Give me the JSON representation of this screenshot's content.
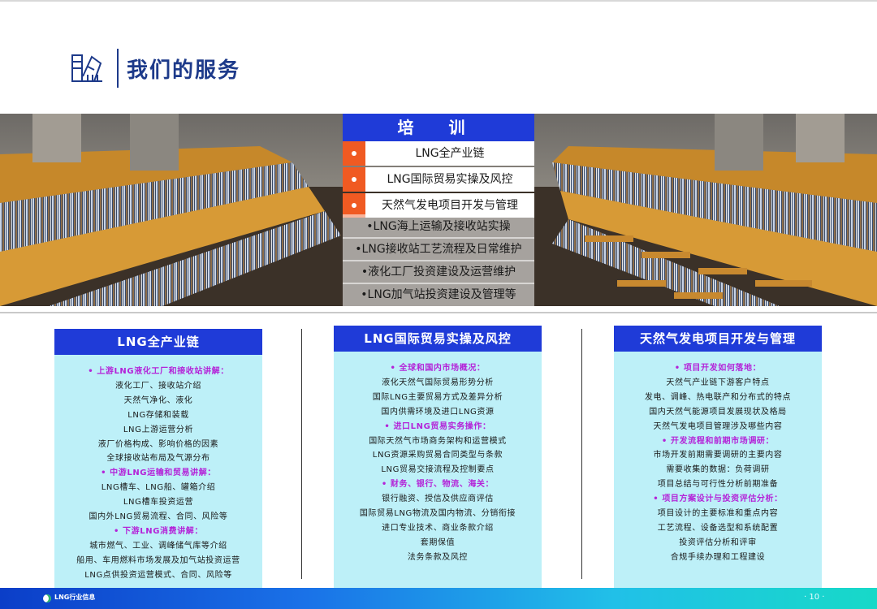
{
  "header": {
    "title": "我们的服务",
    "icon": "document-icon"
  },
  "training": {
    "title": "培 训",
    "main": [
      "LNG全产业链",
      "LNG国际贸易实操及风控",
      "天然气发电项目开发与管理"
    ],
    "sub": [
      "•LNG海上运输及接收站实操",
      "•LNG接收站工艺流程及日常维护",
      "•液化工厂投资建设及运营维护",
      "•LNG加气站投资建设及管理等"
    ]
  },
  "columns": [
    {
      "title": "LNG全产业链",
      "lines": [
        {
          "t": "• 上游LNG液化工厂和接收站讲解：",
          "h": true
        },
        {
          "t": "液化工厂、接收站介绍"
        },
        {
          "t": "天然气净化、液化"
        },
        {
          "t": "LNG存储和装载"
        },
        {
          "t": "LNG上游运营分析"
        },
        {
          "t": "液厂价格构成、影响价格的因素"
        },
        {
          "t": "全球接收站布局及气源分布"
        },
        {
          "t": "• 中游LNG运输和贸易讲解：",
          "h": true
        },
        {
          "t": "LNG槽车、LNG船、罐箱介绍"
        },
        {
          "t": "LNG槽车投资运营"
        },
        {
          "t": "国内外LNG贸易流程、合同、风险等"
        },
        {
          "t": "• 下游LNG消费讲解：",
          "h": true
        },
        {
          "t": "城市燃气、工业、调峰储气库等介绍"
        },
        {
          "t": "船用、车用燃料市场发展及加气站投资运营"
        },
        {
          "t": "LNG点供投资运营模式、合同、风险等"
        }
      ]
    },
    {
      "title": "LNG国际贸易实操及风控",
      "lines": [
        {
          "t": "• 全球和国内市场概况：",
          "h": true
        },
        {
          "t": "液化天然气国际贸易形势分析"
        },
        {
          "t": "国际LNG主要贸易方式及差异分析"
        },
        {
          "t": "国内供需环境及进口LNG资源"
        },
        {
          "t": "• 进口LNG贸易实务操作：",
          "h": true
        },
        {
          "t": "国际天然气市场商务架构和运营模式"
        },
        {
          "t": "LNG资源采购贸易合同类型与条款"
        },
        {
          "t": "LNG贸易交接流程及控制要点"
        },
        {
          "t": "• 财务、银行、物流、海关：",
          "h": true
        },
        {
          "t": "银行融资、授信及供应商评估"
        },
        {
          "t": "国际贸易LNG物流及国内物流、分销衔接"
        },
        {
          "t": "进口专业技术、商业条款介绍"
        },
        {
          "t": "套期保值"
        },
        {
          "t": "法务条款及风控"
        }
      ]
    },
    {
      "title": "天然气发电项目开发与管理",
      "lines": [
        {
          "t": "• 项目开发如何落地：",
          "h": true
        },
        {
          "t": "天然气产业链下游客户特点"
        },
        {
          "t": "发电、调峰、热电联产和分布式的特点"
        },
        {
          "t": "国内天然气能源项目发展现状及格局"
        },
        {
          "t": "天然气发电项目管理涉及哪些内容"
        },
        {
          "t": "• 开发流程和前期市场调研：",
          "h": true
        },
        {
          "t": "市场开发前期需要调研的主要内容"
        },
        {
          "t": "需要收集的数据：负荷调研"
        },
        {
          "t": "项目总结与可行性分析前期准备"
        },
        {
          "t": "• 项目方案设计与投资评估分析：",
          "h": true
        },
        {
          "t": "项目设计的主要标准和重点内容"
        },
        {
          "t": "工艺流程、设备选型和系统配置"
        },
        {
          "t": "投资评估分析和评审"
        },
        {
          "t": "合规手续办理和工程建设"
        }
      ]
    }
  ],
  "footer": {
    "label": "LNG行业信息",
    "page": "· 10 ·"
  },
  "colors": {
    "blue": "#1f3bd8",
    "orange": "#f05a22",
    "cyan_box": "#bdf0f8",
    "highlight": "#b424d8"
  }
}
